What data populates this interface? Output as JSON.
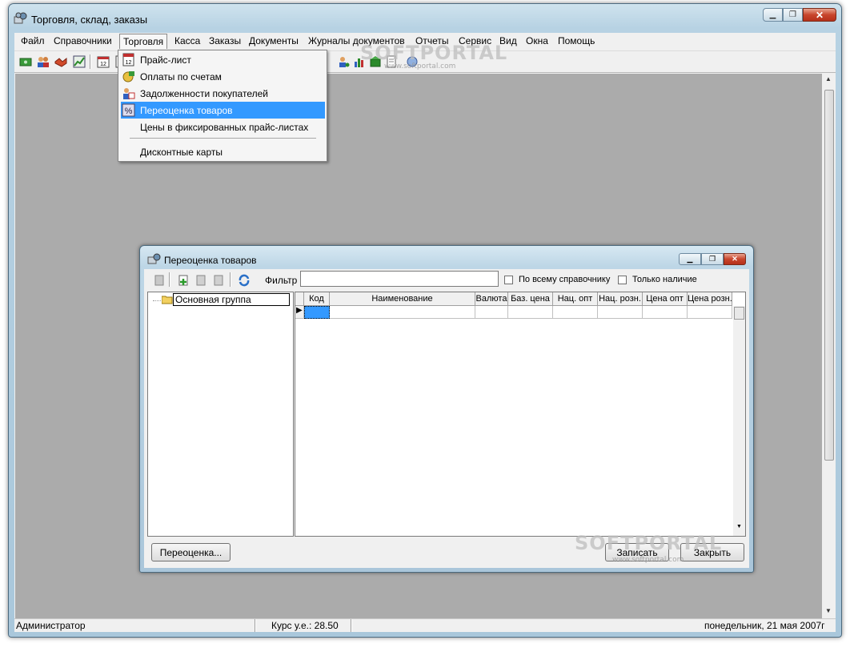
{
  "window": {
    "title": "Торговля, склад, заказы"
  },
  "menubar": {
    "items": [
      "Файл",
      "Справочники",
      "Торговля",
      "Касса",
      "Заказы",
      "Документы",
      "Журналы документов",
      "Отчеты",
      "Сервис",
      "Вид",
      "Окна",
      "Помощь"
    ],
    "active": "Торговля"
  },
  "dropdown": {
    "items": [
      {
        "label": "Прайс-лист",
        "icon": "price-list-icon"
      },
      {
        "label": "Оплаты по счетам",
        "icon": "payments-icon"
      },
      {
        "label": "Задолженности покупателей",
        "icon": "debts-icon"
      },
      {
        "label": "Переоценка товаров",
        "icon": "revaluation-icon",
        "highlighted": true
      },
      {
        "label": "Цены в фиксированных прайс-листах",
        "icon": ""
      },
      {
        "label": "Дисконтные карты",
        "icon": ""
      }
    ]
  },
  "child": {
    "title": "Переоценка товаров",
    "filter_label": "Фильтр",
    "filter_value": "",
    "check_all_label": "По всему справочнику",
    "check_stock_label": "Только наличие",
    "tree_root": "Основная группа",
    "columns": [
      "Код",
      "Наименование",
      "Валюта",
      "Баз. цена",
      "Нац. опт",
      "Нац. розн.",
      "Цена опт",
      "Цена розн."
    ],
    "revalue_button": "Переоценка...",
    "save_button": "Записать",
    "close_button": "Закрыть"
  },
  "statusbar": {
    "user": "Администратор",
    "rate": "Курс у.е.: 28.50",
    "date": "понедельник, 21 мая 2007г"
  },
  "watermark": {
    "brand": "SOFTPORTAL",
    "url": "www.softportal.com"
  },
  "colors": {
    "highlight": "#3399ff",
    "mdi_background": "#ababab"
  }
}
